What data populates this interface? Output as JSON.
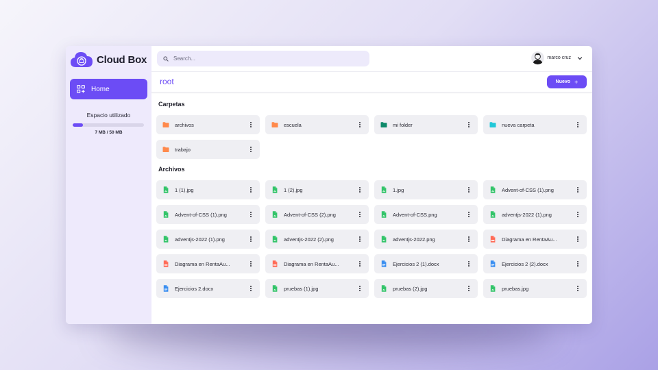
{
  "app": {
    "name": "Cloud Box"
  },
  "sidebar": {
    "nav": [
      {
        "label": "Home",
        "icon": "grid-icon"
      }
    ],
    "storage": {
      "title": "Espacio utilizado",
      "used_text": "7 MB / 50 MB",
      "used_fraction": 0.14
    }
  },
  "header": {
    "search_placeholder": "Search...",
    "user_name": "marco cruz"
  },
  "breadcrumb": {
    "current": "root"
  },
  "actions": {
    "new_label": "Nuevo",
    "new_icon": "+"
  },
  "colors": {
    "accent": "#6c4cf5",
    "folder_orange": "#ff8a4c",
    "folder_green": "#0e8a6a",
    "folder_cyan": "#22c8d8",
    "file_green": "#34c46a",
    "file_red": "#ff6b57",
    "file_blue": "#3a8ef0"
  },
  "folders_section": {
    "title": "Carpetas",
    "items": [
      {
        "name": "archivos",
        "color": "#ff8a4c"
      },
      {
        "name": "escuela",
        "color": "#ff8a4c"
      },
      {
        "name": "mi folder",
        "color": "#0e8a6a"
      },
      {
        "name": "nueva carpeta",
        "color": "#22c8d8"
      },
      {
        "name": "trabajo",
        "color": "#ff8a4c"
      }
    ]
  },
  "files_section": {
    "title": "Archivos",
    "items": [
      {
        "name": "1 (1).jpg",
        "type": "image",
        "color": "#34c46a"
      },
      {
        "name": "1 (2).jpg",
        "type": "image",
        "color": "#34c46a"
      },
      {
        "name": "1.jpg",
        "type": "image",
        "color": "#34c46a"
      },
      {
        "name": "Advent-of-CSS (1).png",
        "type": "image",
        "color": "#34c46a"
      },
      {
        "name": "Advent-of-CSS (1).png",
        "type": "image",
        "color": "#34c46a"
      },
      {
        "name": "Advent-of-CSS (2).png",
        "type": "image",
        "color": "#34c46a"
      },
      {
        "name": "Advent-of-CSS.png",
        "type": "image",
        "color": "#34c46a"
      },
      {
        "name": "adventjs-2022 (1).png",
        "type": "image",
        "color": "#34c46a"
      },
      {
        "name": "adventjs-2022 (1).png",
        "type": "image",
        "color": "#34c46a"
      },
      {
        "name": "adventjs-2022 (2).png",
        "type": "image",
        "color": "#34c46a"
      },
      {
        "name": "adventjs-2022.png",
        "type": "image",
        "color": "#34c46a"
      },
      {
        "name": "Diagrama en RentaAu...",
        "type": "pdf",
        "color": "#ff6b57"
      },
      {
        "name": "Diagrama en RentaAu...",
        "type": "pdf",
        "color": "#ff6b57"
      },
      {
        "name": "Diagrama en RentaAu...",
        "type": "pdf",
        "color": "#ff6b57"
      },
      {
        "name": "Ejercicios 2 (1).docx",
        "type": "doc",
        "color": "#3a8ef0"
      },
      {
        "name": "Ejercicios 2 (2).docx",
        "type": "doc",
        "color": "#3a8ef0"
      },
      {
        "name": "Ejercicios 2.docx",
        "type": "doc",
        "color": "#3a8ef0"
      },
      {
        "name": "pruebas (1).jpg",
        "type": "image",
        "color": "#34c46a"
      },
      {
        "name": "pruebas (2).jpg",
        "type": "image",
        "color": "#34c46a"
      },
      {
        "name": "pruebas.jpg",
        "type": "image",
        "color": "#34c46a"
      }
    ]
  }
}
